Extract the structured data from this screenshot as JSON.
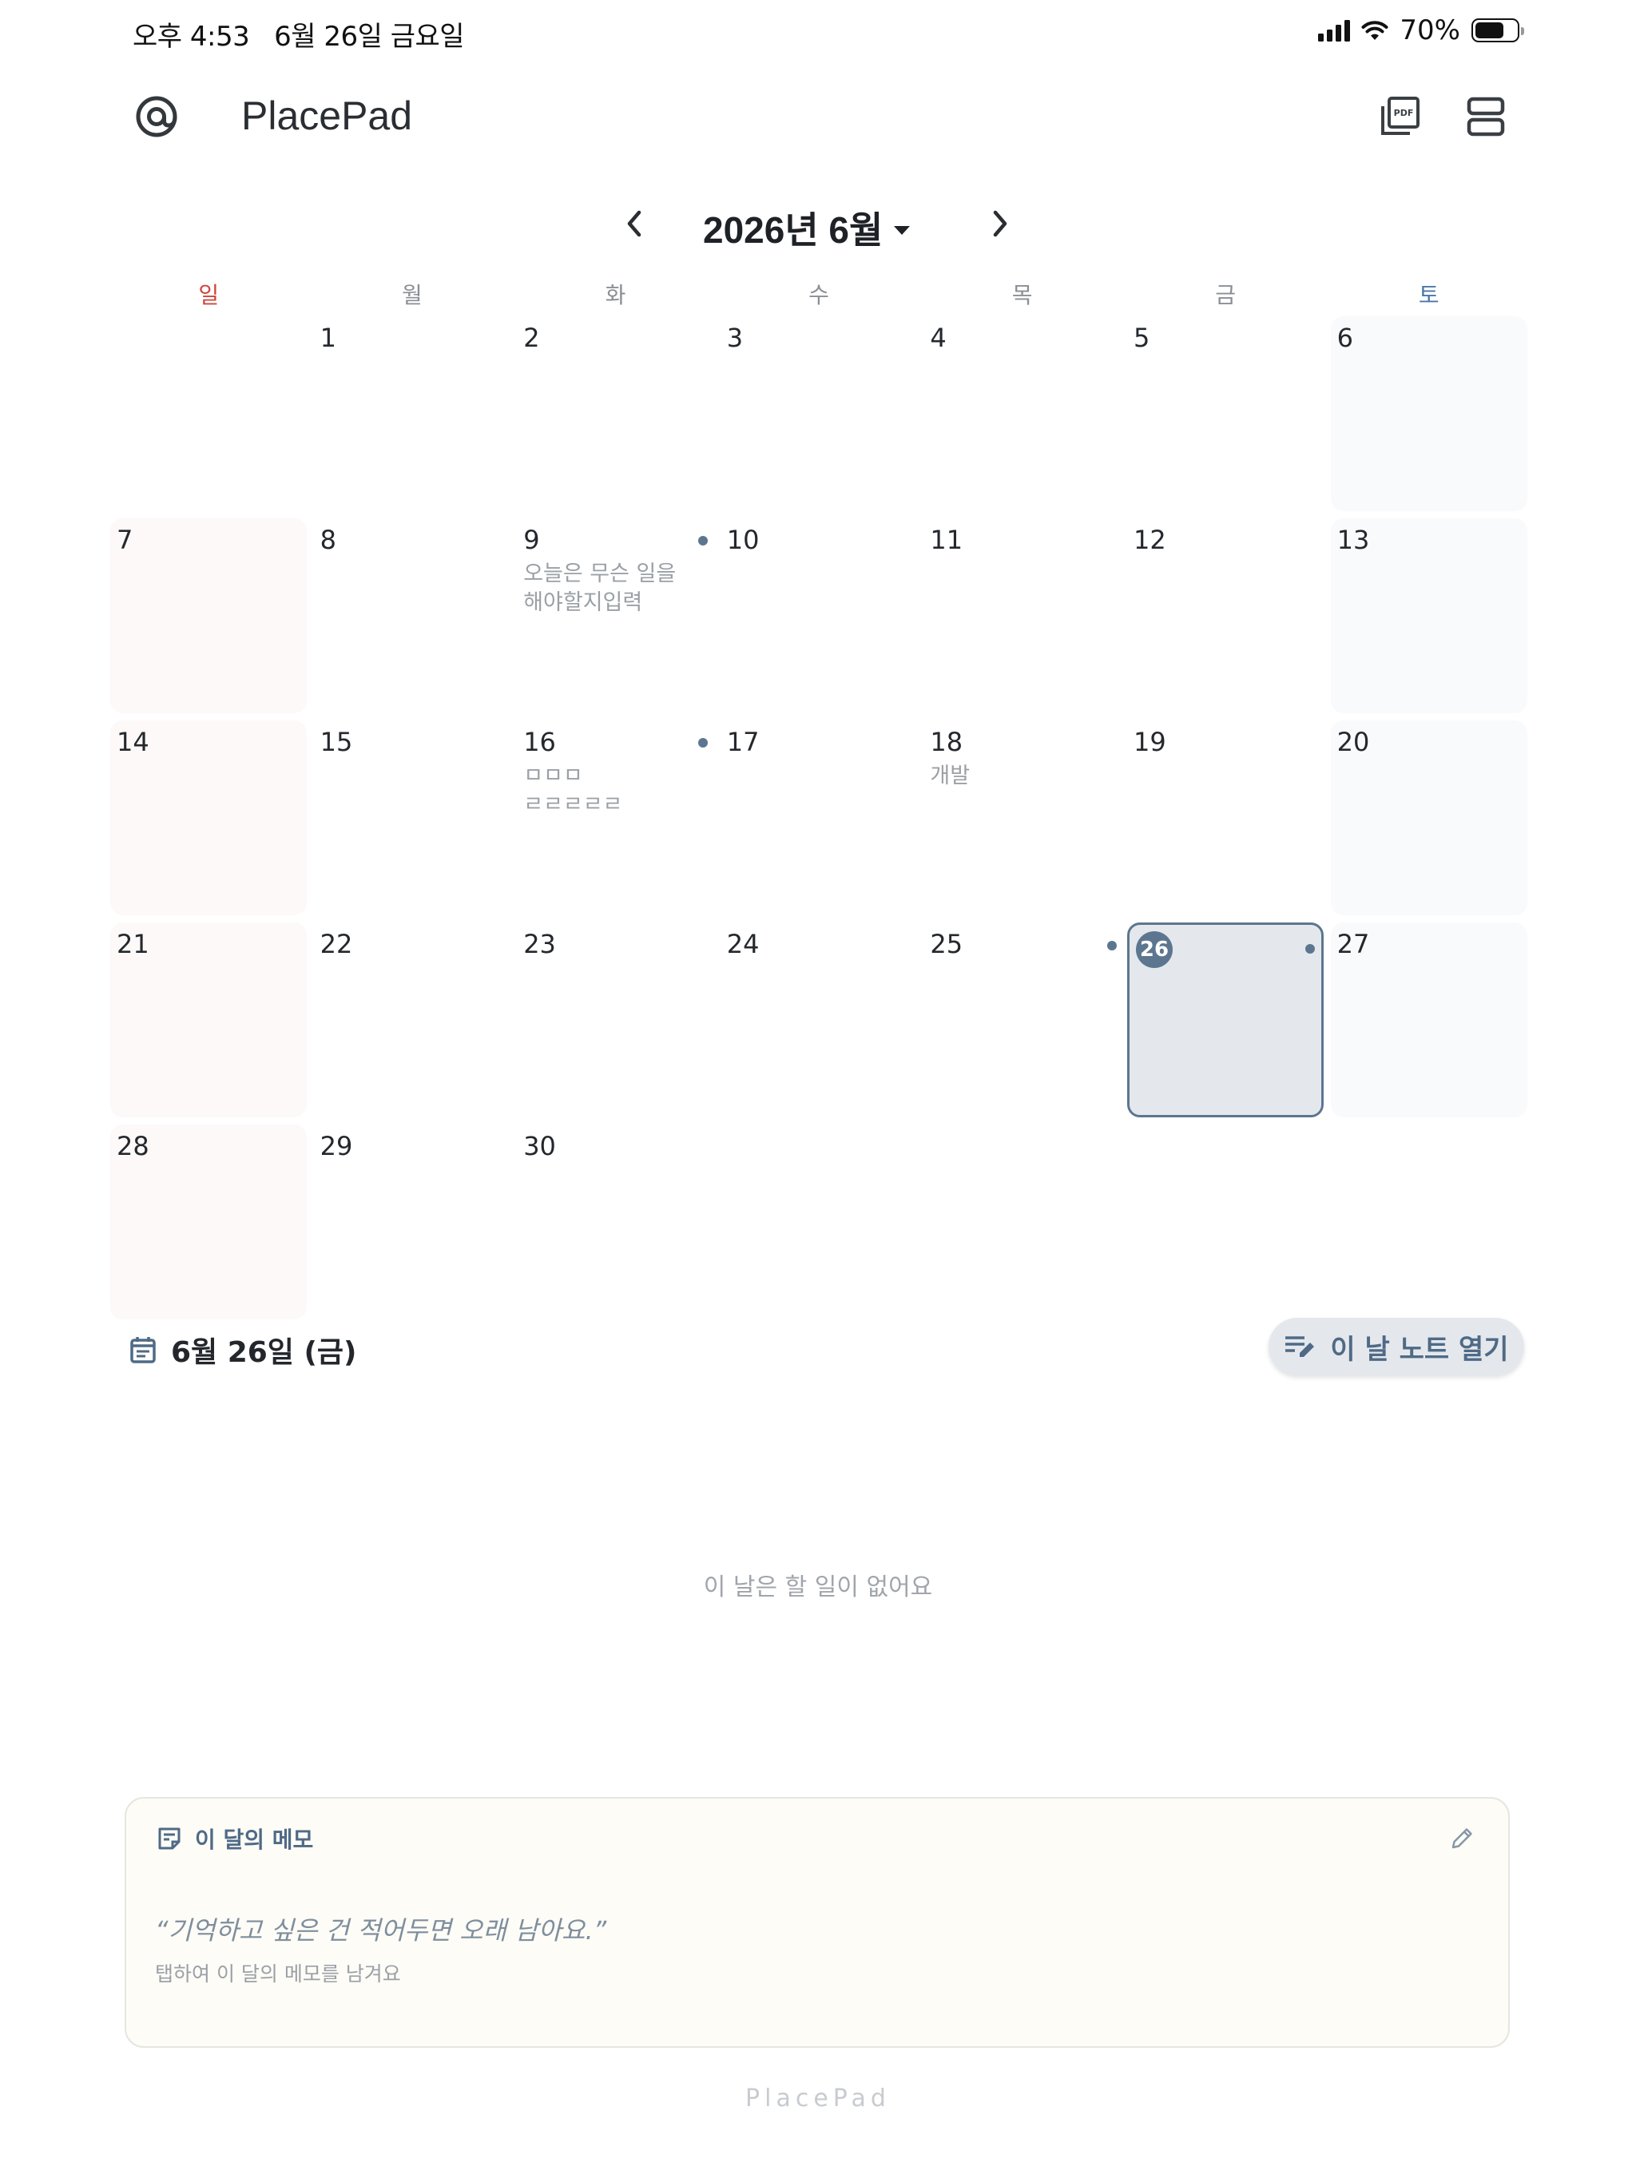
{
  "status_bar": {
    "time": "오후 4:53",
    "date": "6월 26일 금요일",
    "battery": "70%"
  },
  "header": {
    "app_title": "PlacePad",
    "logo_icon": "at-sign-icon",
    "pdf_icon": "pdf-export-icon",
    "layout_icon": "view-toggle-icon"
  },
  "calendar": {
    "month_title": "2026년 6월",
    "weekdays": [
      "일",
      "월",
      "화",
      "수",
      "목",
      "금",
      "토"
    ],
    "weeks": [
      [
        {
          "day": ""
        },
        {
          "day": "1"
        },
        {
          "day": "2"
        },
        {
          "day": "3"
        },
        {
          "day": "4"
        },
        {
          "day": "5"
        },
        {
          "day": "6"
        }
      ],
      [
        {
          "day": "7"
        },
        {
          "day": "8"
        },
        {
          "day": "9",
          "preview": "오늘은 무슨 일을\n해야할지입력"
        },
        {
          "day": "10"
        },
        {
          "day": "11"
        },
        {
          "day": "12"
        },
        {
          "day": "13"
        }
      ],
      [
        {
          "day": "14"
        },
        {
          "day": "15"
        },
        {
          "day": "16",
          "preview": "ㅁㅁㅁ\nㄹㄹㄹㄹㄹ"
        },
        {
          "day": "17"
        },
        {
          "day": "18",
          "preview": "개발"
        },
        {
          "day": "19"
        },
        {
          "day": "20"
        }
      ],
      [
        {
          "day": "21"
        },
        {
          "day": "22"
        },
        {
          "day": "23"
        },
        {
          "day": "24"
        },
        {
          "day": "25"
        },
        {
          "day": "26",
          "today": true
        },
        {
          "day": "27"
        }
      ],
      [
        {
          "day": "28"
        },
        {
          "day": "29"
        },
        {
          "day": "30"
        },
        {
          "day": ""
        },
        {
          "day": ""
        },
        {
          "day": ""
        },
        {
          "day": ""
        }
      ]
    ]
  },
  "selected_day": {
    "label": "6월 26일 (금)",
    "open_note_label": "이 날 노트 열기",
    "empty_message": "이 날은 할 일이 없어요"
  },
  "memo": {
    "title": "이 달의 메모",
    "quote": "“기억하고 싶은 건 적어두면 오래 남아요.”",
    "hint": "탭하여 이 달의 메모를 남겨요"
  },
  "footer": "PlacePad",
  "colors": {
    "accent": "#5d7690",
    "sunday": "#d0443b",
    "saturday": "#4a77a8"
  }
}
